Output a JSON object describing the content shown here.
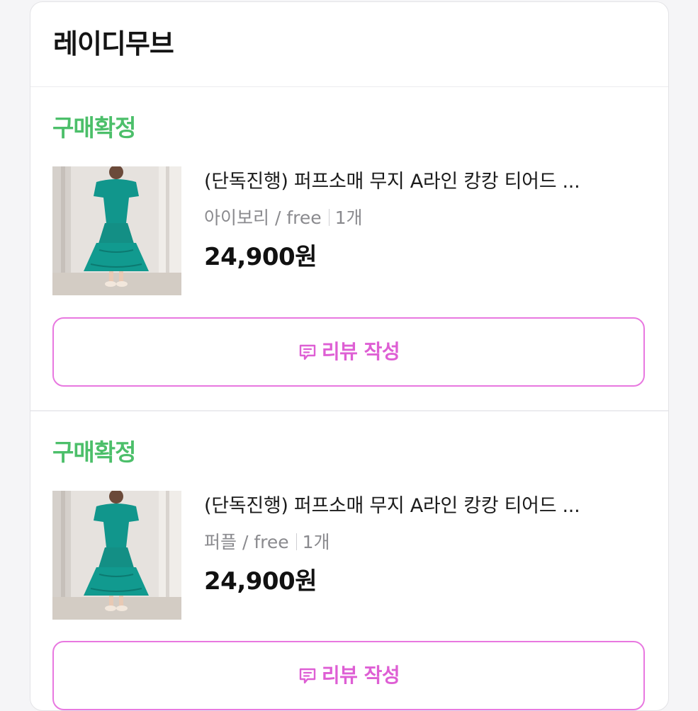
{
  "store": {
    "name": "레이디무브"
  },
  "orders": [
    {
      "status": "구매확정",
      "product_name": "(단독진행) 퍼프소매 무지 A라인 캉캉 티어드 ...",
      "option": "아이보리 / free",
      "quantity": "1개",
      "price": "24,900원",
      "review_label": "리뷰 작성"
    },
    {
      "status": "구매확정",
      "product_name": "(단독진행) 퍼프소매 무지 A라인 캉캉 티어드 ...",
      "option": "퍼플 / free",
      "quantity": "1개",
      "price": "24,900원",
      "review_label": "리뷰 작성"
    }
  ],
  "colors": {
    "status_green": "#4cbf6a",
    "review_pink": "#de5fd4",
    "review_border": "#e878e0"
  },
  "icons": {
    "product_thumbnail": "dress-photo",
    "review_button": "comment-icon"
  }
}
